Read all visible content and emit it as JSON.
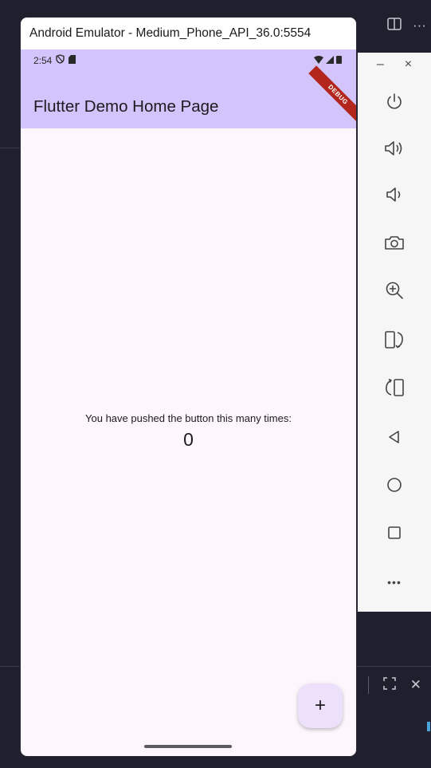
{
  "emulator": {
    "window_title": "Android Emulator - Medium_Phone_API_36.0:5554"
  },
  "status_bar": {
    "time": "2:54"
  },
  "app": {
    "title": "Flutter Demo Home Page",
    "debug_label": "DEBUG",
    "push_message": "You have pushed the button this many times:",
    "counter": "0",
    "fab_label": "+"
  },
  "toolbar": {
    "minimize": "–",
    "close": "×",
    "more": "•••"
  },
  "ide": {
    "overflow": "···",
    "close": "✕"
  },
  "colors": {
    "app_bar": "#d3c4fb",
    "surface": "#fdf7fd",
    "fab": "#ece0fb"
  }
}
